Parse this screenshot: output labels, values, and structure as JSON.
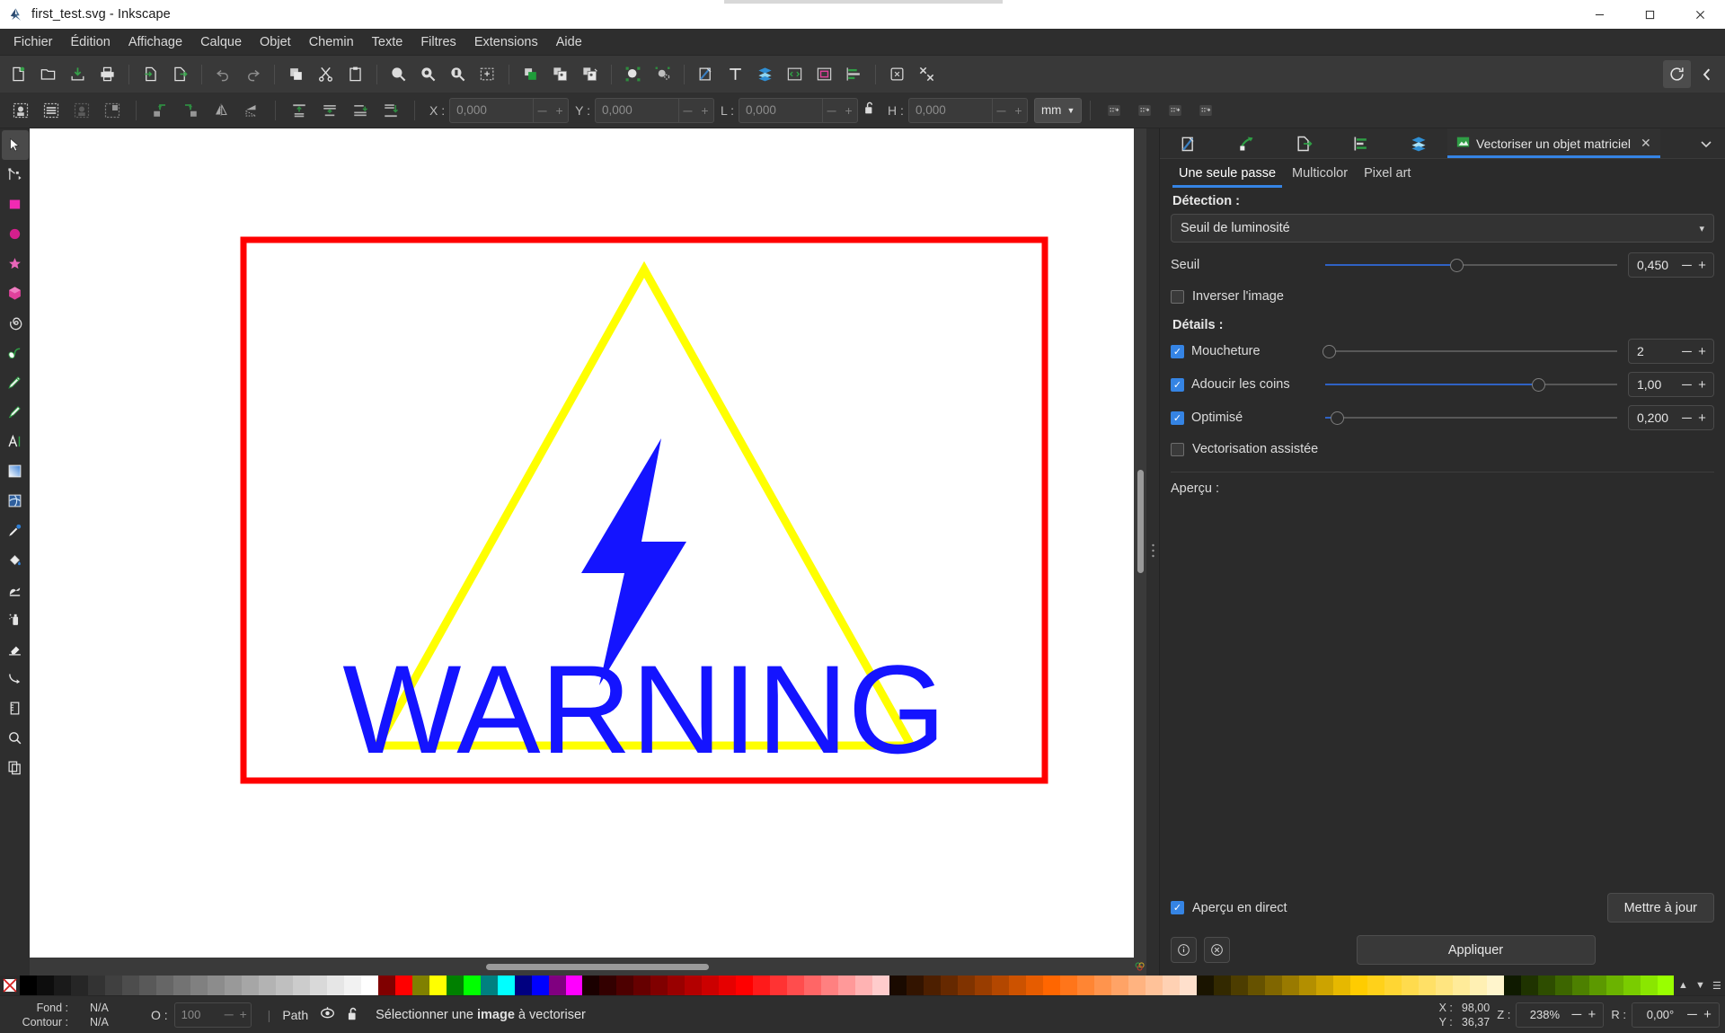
{
  "window": {
    "title": "first_test.svg - Inkscape",
    "app_icon": "inkscape-logo-icon",
    "controls": {
      "minimize": "─",
      "maximize": "☐",
      "close": "✕"
    }
  },
  "menubar": {
    "items": [
      {
        "label": "Fichier"
      },
      {
        "label": "Édition"
      },
      {
        "label": "Affichage"
      },
      {
        "label": "Calque"
      },
      {
        "label": "Objet"
      },
      {
        "label": "Chemin"
      },
      {
        "label": "Texte"
      },
      {
        "label": "Filtres"
      },
      {
        "label": "Extensions"
      },
      {
        "label": "Aide"
      }
    ]
  },
  "commandbar": {
    "groups": [
      [
        "new-document-icon",
        "open-document-icon",
        "save-document-icon",
        "print-icon"
      ],
      [
        "import-icon",
        "export-icon"
      ],
      [
        "undo-icon",
        "redo-icon"
      ],
      [
        "copy-icon",
        "cut-icon",
        "paste-icon"
      ],
      [
        "zoom-selection-icon",
        "zoom-drawing-icon",
        "zoom-page-icon",
        "zoom-fit-icon"
      ],
      [
        "duplicate-icon",
        "group-icon",
        "ungroup-icon"
      ],
      [
        "object-properties-icon",
        "clone-icon"
      ],
      [
        "fill-stroke-icon",
        "text-properties-icon",
        "layers-icon",
        "xml-editor-icon",
        "document-properties-icon",
        "align-distribute-icon"
      ],
      [
        "preferences-object-icon",
        "preferences-icon"
      ]
    ],
    "right": [
      "rotate-view-icon",
      "collapse-panel-icon"
    ]
  },
  "toolbar_options": {
    "select_modes": [
      "select-all-icon",
      "select-all-layers-icon",
      "select-same-icon",
      "select-rubberband-icon"
    ],
    "transform": [
      "rotate-ccw-icon",
      "rotate-cw-icon",
      "flip-horizontal-icon",
      "flip-vertical-icon"
    ],
    "raise_lower": [
      "raise-to-top-icon",
      "raise-icon",
      "lower-icon",
      "lower-to-bottom-icon"
    ],
    "fields": [
      {
        "name": "X",
        "label": "X :",
        "value": "0,000"
      },
      {
        "name": "Y",
        "label": "Y :",
        "value": "0,000"
      },
      {
        "name": "W",
        "label": "L :",
        "value": "0,000"
      },
      {
        "name": "H",
        "label": "H :",
        "value": "0,000"
      }
    ],
    "lock_icon": "lock-open-icon",
    "unit": "mm",
    "affect_buttons": [
      "affect-stroke-width-icon",
      "affect-corners-icon",
      "affect-gradients-icon",
      "affect-patterns-icon"
    ]
  },
  "toolbox": {
    "tools": [
      {
        "name": "selector-tool",
        "icon": "arrow-cursor-icon",
        "active": true
      },
      {
        "name": "node-tool",
        "icon": "node-editor-icon",
        "active": false
      },
      {
        "name": "rectangle-tool",
        "icon": "square-icon",
        "active": false
      },
      {
        "name": "ellipse-tool",
        "icon": "circle-icon",
        "active": false
      },
      {
        "name": "star-tool",
        "icon": "star-icon",
        "active": false
      },
      {
        "name": "3dbox-tool",
        "icon": "cube-icon",
        "active": false
      },
      {
        "name": "spiral-tool",
        "icon": "spiral-icon",
        "active": false
      },
      {
        "name": "pencil-tool",
        "icon": "pencil-freehand-icon",
        "active": false
      },
      {
        "name": "pen-tool",
        "icon": "bezier-pen-icon",
        "active": false
      },
      {
        "name": "calligraphy-tool",
        "icon": "calligraphy-brush-icon",
        "active": false
      },
      {
        "name": "text-tool",
        "icon": "text-a-icon",
        "active": false
      },
      {
        "name": "gradient-tool",
        "icon": "gradient-square-icon",
        "active": false
      },
      {
        "name": "mesh-tool",
        "icon": "mesh-gradient-icon",
        "active": false
      },
      {
        "name": "dropper-tool",
        "icon": "eyedropper-icon",
        "active": false
      },
      {
        "name": "paintbucket-tool",
        "icon": "paint-bucket-icon",
        "active": false
      },
      {
        "name": "tweak-tool",
        "icon": "tweak-hand-icon",
        "active": false
      },
      {
        "name": "spray-tool",
        "icon": "spray-can-icon",
        "active": false
      },
      {
        "name": "eraser-tool",
        "icon": "eraser-icon",
        "active": false
      },
      {
        "name": "connector-tool",
        "icon": "connector-arrow-icon",
        "active": false
      },
      {
        "name": "measure-tool",
        "icon": "measure-ruler-icon",
        "active": false
      },
      {
        "name": "zoom-tool",
        "icon": "magnifier-icon",
        "active": false
      },
      {
        "name": "pages-tool",
        "icon": "pages-icon",
        "active": false
      }
    ]
  },
  "canvas": {
    "artwork": {
      "border_color": "#ff0000",
      "triangle_color": "#ffff00",
      "bolt_color": "#1414ff",
      "text": "WARNING",
      "text_color": "#1414ff"
    },
    "zoom_1to1_icon": "zoom-1-to-1-icon",
    "drawing_handle_icon": "canvas-rotate-icon"
  },
  "dock": {
    "tabs": [
      {
        "name": "fill-stroke-tab",
        "icon": "pen-edit-icon"
      },
      {
        "name": "objects-tab",
        "icon": "objects-green-icon"
      },
      {
        "name": "export-tab",
        "icon": "export-page-icon"
      },
      {
        "name": "align-tab",
        "icon": "align-green-icon"
      },
      {
        "name": "layers-tab",
        "icon": "layers-blue-icon"
      }
    ],
    "active_tab": {
      "label": "Vectoriser un objet matriciel",
      "icon": "trace-bitmap-icon",
      "close": "✕"
    },
    "chevron": "chevron-down-icon",
    "subtabs": [
      {
        "label": "Une seule passe",
        "selected": true
      },
      {
        "label": "Multicolor",
        "selected": false
      },
      {
        "label": "Pixel art",
        "selected": false
      }
    ],
    "detection": {
      "title": "Détection :",
      "mode": "Seuil de luminosité",
      "caret": "▾",
      "threshold": {
        "label": "Seuil",
        "value": "0,450",
        "fraction": 0.45
      },
      "invert": {
        "label": "Inverser l'image",
        "checked": false
      }
    },
    "details": {
      "title": "Détails :",
      "items": [
        {
          "name": "speckles",
          "label": "Moucheture",
          "checked": true,
          "value": "2",
          "fraction": 0.01
        },
        {
          "name": "smooth-corners",
          "label": "Adoucir les coins",
          "checked": true,
          "value": "1,00",
          "fraction": 0.73
        },
        {
          "name": "optimize",
          "label": "Optimisé",
          "checked": true,
          "value": "0,200",
          "fraction": 0.04
        }
      ],
      "assisted": {
        "label": "Vectorisation assistée",
        "checked": false
      }
    },
    "preview": {
      "label": "Aperçu :"
    },
    "footer": {
      "live_preview": {
        "label": "Aperçu en direct",
        "checked": true
      },
      "update_button": "Mettre à jour",
      "apply_button": "Appliquer",
      "info_icon": "info-circle-icon",
      "reset_icon": "reset-circle-icon"
    }
  },
  "palette": {
    "none_icon": "no-color-x-icon",
    "swatches": [
      "#000000",
      "#0d0d0d",
      "#1a1a1a",
      "#262626",
      "#333333",
      "#404040",
      "#4d4d4d",
      "#595959",
      "#666666",
      "#737373",
      "#808080",
      "#8c8c8c",
      "#999999",
      "#a6a6a6",
      "#b3b3b3",
      "#bfbfbf",
      "#cccccc",
      "#d9d9d9",
      "#e6e6e6",
      "#f2f2f2",
      "#ffffff",
      "#800000",
      "#ff0000",
      "#808000",
      "#ffff00",
      "#008000",
      "#00ff00",
      "#008080",
      "#00ffff",
      "#000080",
      "#0000ff",
      "#800080",
      "#ff00ff",
      "#1a0000",
      "#330000",
      "#4d0000",
      "#660000",
      "#800000",
      "#990000",
      "#b30000",
      "#cc0000",
      "#e60000",
      "#ff0000",
      "#ff1a1a",
      "#ff3333",
      "#ff4d4d",
      "#ff6666",
      "#ff8080",
      "#ff9999",
      "#ffb3b3",
      "#ffcccc",
      "#1a0a00",
      "#331400",
      "#4d1f00",
      "#662900",
      "#803300",
      "#993d00",
      "#b34700",
      "#cc5200",
      "#e65c00",
      "#ff6600",
      "#ff751a",
      "#ff8533",
      "#ff944d",
      "#ffa366",
      "#ffb380",
      "#ffc299",
      "#ffd1b3",
      "#ffe0cc",
      "#1a1400",
      "#332900",
      "#4d3d00",
      "#665200",
      "#806600",
      "#997a00",
      "#b38f00",
      "#cca300",
      "#e6b800",
      "#ffcc00",
      "#ffd11a",
      "#ffd633",
      "#ffdb4d",
      "#ffe066",
      "#ffe580",
      "#ffeb99",
      "#fff0b3",
      "#fff5cc",
      "#0f1a00",
      "#1f3300",
      "#2e4d00",
      "#3d6600",
      "#4d8000",
      "#5c9900",
      "#6bb300",
      "#7acc00",
      "#8ae600",
      "#99ff00"
    ],
    "scroll_up_icon": "chevron-up-icon",
    "scroll_down_icon": "chevron-down-icon",
    "menu_icon": "palette-menu-icon"
  },
  "statusbar": {
    "fill_label": "Fond :",
    "fill_value": "N/A",
    "stroke_label": "Contour :",
    "stroke_value": "N/A",
    "opacity_label": "O :",
    "opacity_value": "100",
    "layer_name": "Path",
    "layer_visible_icon": "eye-icon",
    "layer_lock_icon": "lock-open-icon",
    "message_prefix": "Sélectionner une ",
    "message_bold": "image",
    "message_suffix": " à vectoriser",
    "x_label": "X :",
    "x_value": "98,00",
    "y_label": "Y :",
    "y_value": "36,37",
    "zoom_label": "Z :",
    "zoom_value": "238%",
    "rotate_label": "R :",
    "rotate_value": "0,00°",
    "minus": "─",
    "plus": "+"
  }
}
